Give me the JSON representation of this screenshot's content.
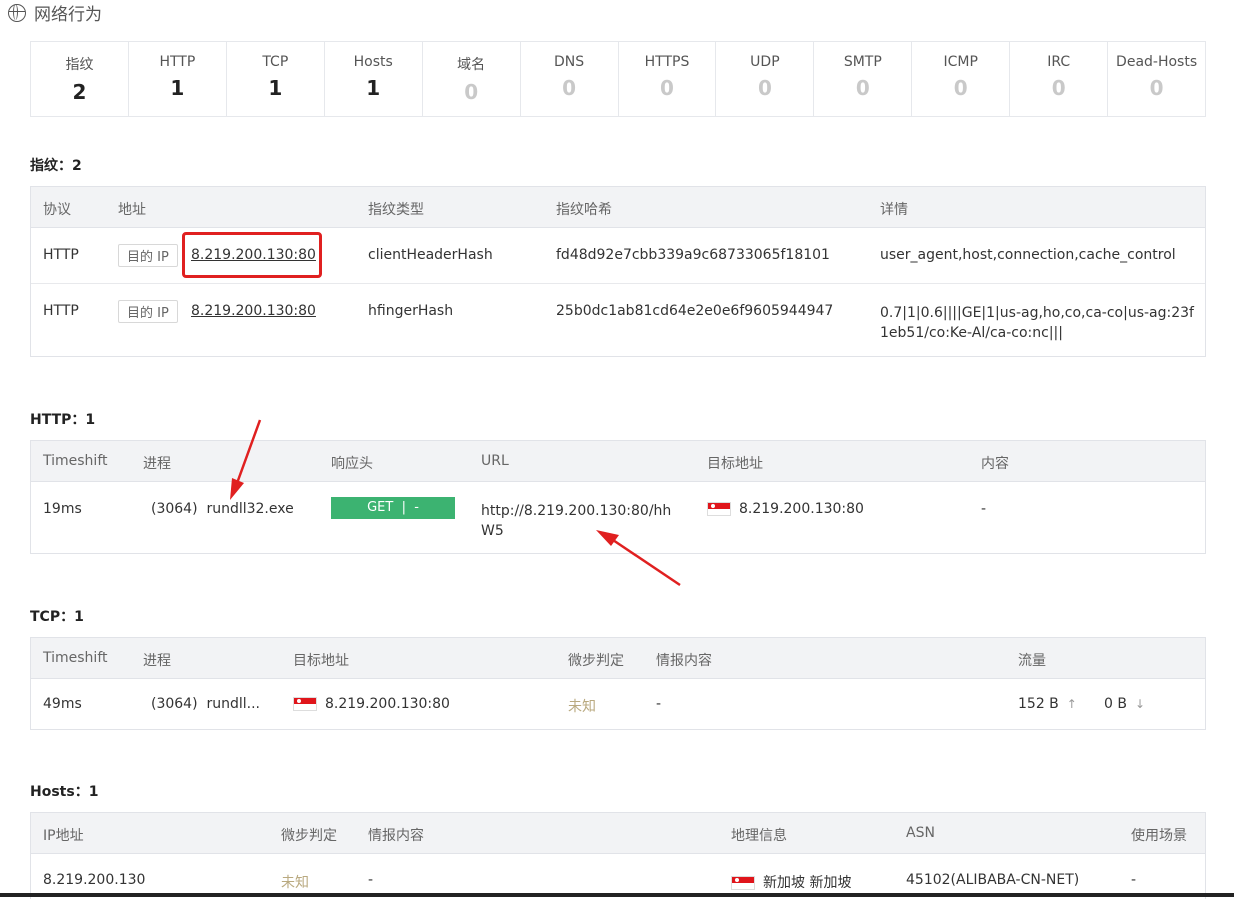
{
  "header": {
    "title": "网络行为",
    "icon": "globe-icon"
  },
  "stats": [
    {
      "label": "指纹",
      "value": "2"
    },
    {
      "label": "HTTP",
      "value": "1"
    },
    {
      "label": "TCP",
      "value": "1"
    },
    {
      "label": "Hosts",
      "value": "1"
    },
    {
      "label": "域名",
      "value": "0"
    },
    {
      "label": "DNS",
      "value": "0"
    },
    {
      "label": "HTTPS",
      "value": "0"
    },
    {
      "label": "UDP",
      "value": "0"
    },
    {
      "label": "SMTP",
      "value": "0"
    },
    {
      "label": "ICMP",
      "value": "0"
    },
    {
      "label": "IRC",
      "value": "0"
    },
    {
      "label": "Dead-Hosts",
      "value": "0"
    }
  ],
  "fingerprint": {
    "title": "指纹：2",
    "headers": {
      "protocol": "协议",
      "address": "地址",
      "type": "指纹类型",
      "hash": "指纹哈希",
      "detail": "详情"
    },
    "rows": [
      {
        "protocol": "HTTP",
        "tag": "目的 IP",
        "address": "8.219.200.130:80",
        "type": "clientHeaderHash",
        "hash": "fd48d92e7cbb339a9c68733065f18101",
        "detail": "user_agent,host,connection,cache_control"
      },
      {
        "protocol": "HTTP",
        "tag": "目的 IP",
        "address": "8.219.200.130:80",
        "type": "hfingerHash",
        "hash": "25b0dc1ab81cd64e2e0e6f9605944947",
        "detail": "0.7|1|0.6||||GE|1|us-ag,ho,co,ca-co|us-ag:23f1eb51/co:Ke-Al/ca-co:nc|||"
      }
    ]
  },
  "http": {
    "title": "HTTP：1",
    "headers": {
      "timeshift": "Timeshift",
      "process": "进程",
      "resp": "响应头",
      "url": "URL",
      "target": "目标地址",
      "content": "内容"
    },
    "rows": [
      {
        "timeshift": "19ms",
        "process": "(3064)  rundll32.exe",
        "method": "GET  |  -",
        "url": "http://8.219.200.130:80/hhW5",
        "target": "8.219.200.130:80",
        "content": "-"
      }
    ]
  },
  "tcp": {
    "title": "TCP：1",
    "headers": {
      "timeshift": "Timeshift",
      "process": "进程",
      "target": "目标地址",
      "verdict": "微步判定",
      "intel": "情报内容",
      "traffic": "流量"
    },
    "rows": [
      {
        "timeshift": "49ms",
        "process": "(3064)  rundll...",
        "target": "8.219.200.130:80",
        "verdict": "未知",
        "intel": "-",
        "up": "152 B",
        "down": "0 B"
      }
    ]
  },
  "hosts": {
    "title": "Hosts：1",
    "headers": {
      "ip": "IP地址",
      "verdict": "微步判定",
      "intel": "情报内容",
      "geo": "地理信息",
      "asn": "ASN",
      "scene": "使用场景"
    },
    "rows": [
      {
        "ip": "8.219.200.130",
        "verdict": "未知",
        "intel": "-",
        "geo": "新加坡 新加坡",
        "asn": "45102(ALIBABA-CN-NET)",
        "scene": "-"
      }
    ]
  },
  "colors": {
    "accent_red": "#e02020",
    "get_green": "#3cb371",
    "flag_red": "#e0151b"
  }
}
